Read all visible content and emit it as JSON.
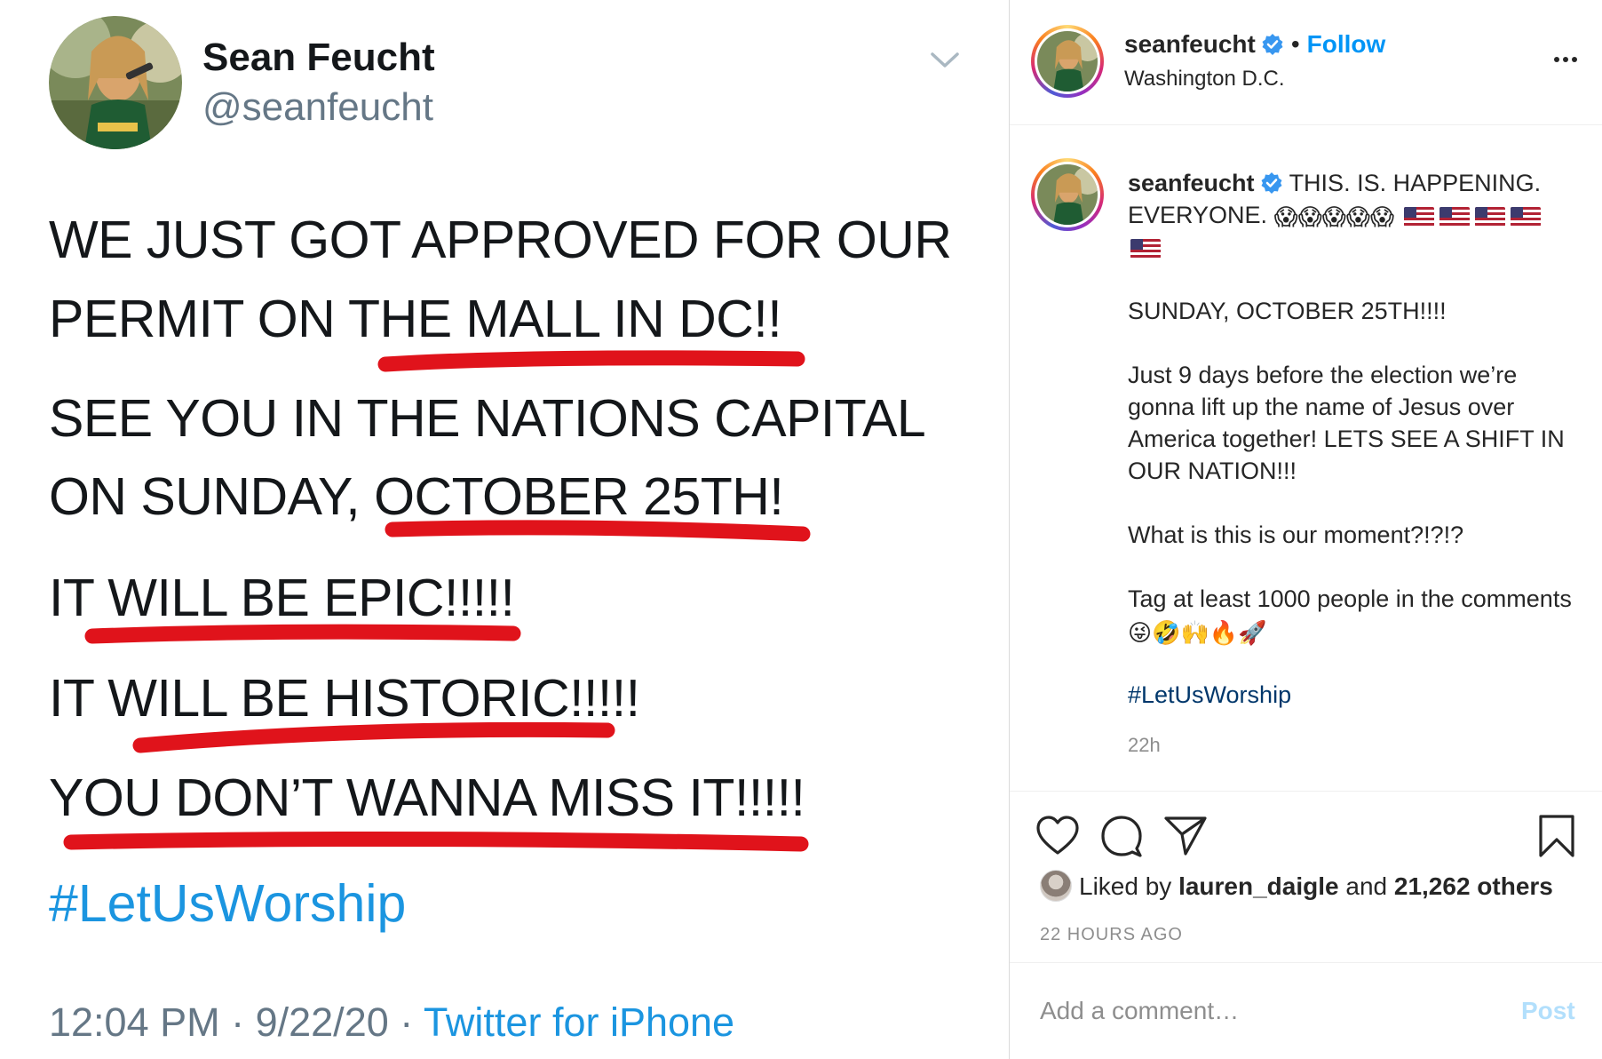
{
  "tweet": {
    "name": "Sean Feucht",
    "handle": "@seanfeucht",
    "lines": [
      "WE JUST GOT APPROVED FOR OUR",
      "PERMIT ON THE MALL IN DC!!",
      "SEE YOU IN THE NATIONS CAPITAL",
      "ON SUNDAY, OCTOBER 25TH!",
      "IT WILL BE EPIC!!!!!",
      "IT WILL BE HISTORIC!!!!!",
      "YOU DON’T WANNA MISS IT!!!!!"
    ],
    "hashtag": "#LetUsWorship",
    "time": "12:04 PM · 9/22/20 · ",
    "source": "Twitter for iPhone",
    "underline_color": "#e0131b",
    "link_color": "#1b95e0"
  },
  "instagram": {
    "header": {
      "username": "seanfeucht",
      "dot": "•",
      "follow_label": "Follow",
      "location": "Washington D.C."
    },
    "caption": {
      "username": "seanfeucht",
      "first_line": "THIS. IS. HAPPENING. EVERYONE.",
      "scream_emoji": "😱",
      "para_date": "SUNDAY, OCTOBER 25TH!!!!",
      "para_main": "Just 9 days before the election we’re gonna lift up the name of Jesus over America together! LETS SEE A SHIFT IN OUR NATION!!!",
      "para_moment": "What is this is our moment?!?!?",
      "para_tag": "Tag at least 1000 people in the comments",
      "tag_emojis": [
        "😜",
        "🤣",
        "🙌",
        "🔥",
        "🚀"
      ],
      "hashtag": "#LetUsWorship",
      "time": "22h"
    },
    "likes": {
      "prefix": "Liked by",
      "liker": "lauren_daigle",
      "middle": "and",
      "others": "21,262 others",
      "ago": "22 HOURS AGO"
    },
    "comment": {
      "placeholder": "Add a comment…",
      "post_label": "Post"
    },
    "colors": {
      "follow": "#0095f6",
      "verified": "#3897f0",
      "hashtag": "#00376b",
      "muted": "#8e8e8e"
    }
  }
}
